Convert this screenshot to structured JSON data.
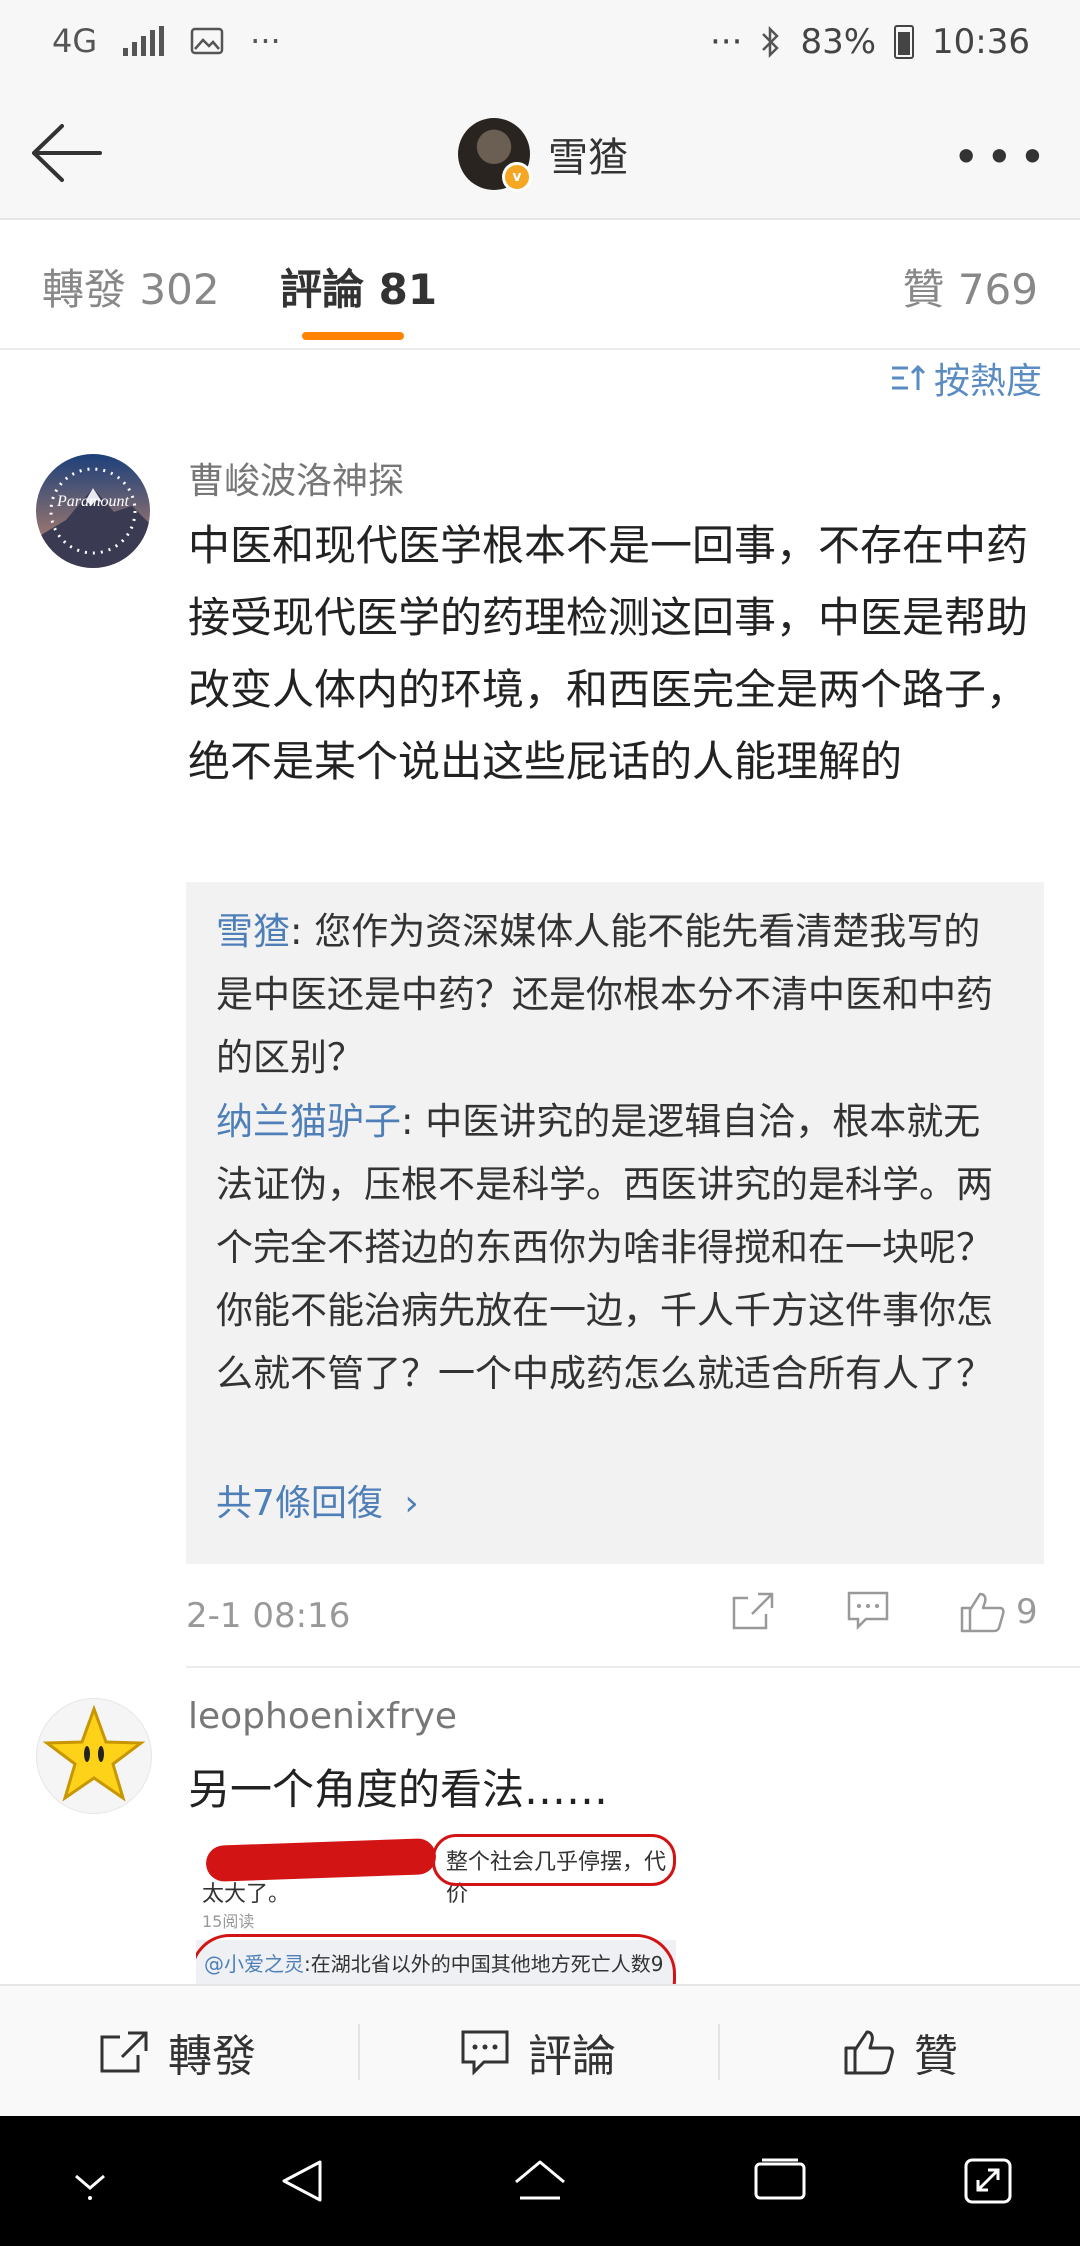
{
  "status_bar": {
    "network": "4G",
    "dots_left": "···",
    "dots_right": "···",
    "battery": "83%",
    "time": "10:36"
  },
  "nav": {
    "title": "雪猹",
    "icons": [
      "back-arrow-icon",
      "more-icon"
    ]
  },
  "tabs": {
    "repost_label": "轉發",
    "repost_count": "302",
    "comment_label": "評論",
    "comment_count": "81",
    "like_label": "贊",
    "like_count": "769"
  },
  "sort_label": "按熱度",
  "comments": [
    {
      "username": "曹峻波洛神探",
      "text": "中医和现代医学根本不是一回事，不存在中药接受现代医学的药理检测这回事，中医是帮助改变人体内的环境，和西医完全是两个路子，绝不是某个说出这些屁话的人能理解的",
      "replies": [
        {
          "name": "雪猹",
          "text": ": 您作为资深媒体人能不能先看清楚我写的是中医还是中药？还是你根本分不清中医和中药的区别？"
        },
        {
          "name": "纳兰猫驴子",
          "text": ": 中医讲究的是逻辑自洽，根本就无法证伪，压根不是科学。西医讲究的是科学。两个完全不搭边的东西你为啥非得搅和在一块呢？你能不能治病先放在一边，千人千方这件事你怎么就不管了？一个中成药怎么就适合所有人了？"
        }
      ],
      "more_replies": "共7條回復",
      "time": "2-1 08:16",
      "likes": "9"
    },
    {
      "username": "leophoenixfrye",
      "text": "另一个角度的看法……",
      "embed": {
        "line1": "整个社会几乎停摆，代价",
        "line2": "太大了。",
        "reads": "15阅读",
        "quote_name": "@小爱之灵",
        "quote_text": ":在湖北省以外的中国其他地方死亡人数9"
      }
    }
  ],
  "bottom_bar": {
    "repost": "轉發",
    "comment": "評論",
    "like": "贊"
  }
}
